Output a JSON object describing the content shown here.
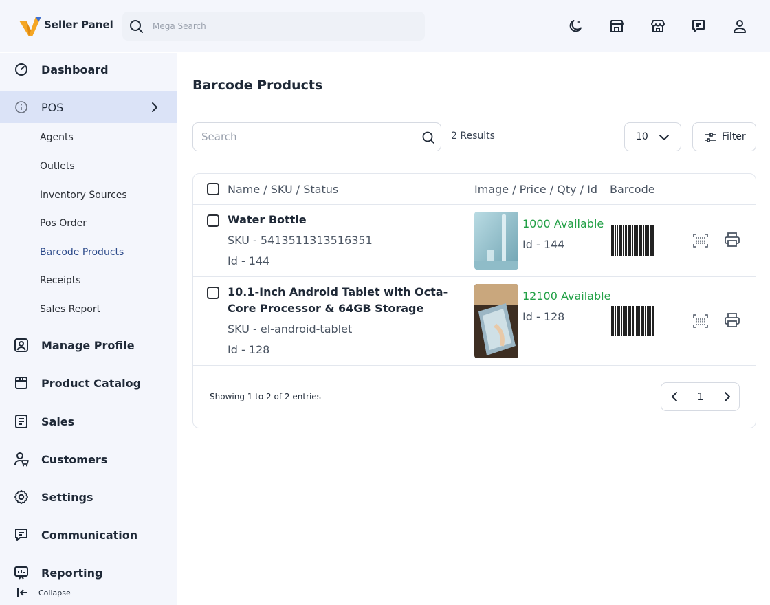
{
  "header": {
    "brand": "Seller Panel",
    "search_placeholder": "Mega Search",
    "icons": [
      "moon-icon",
      "store-icon",
      "shop-icon",
      "message-icon",
      "user-icon"
    ]
  },
  "sidebar": {
    "items": [
      {
        "label": "Dashboard",
        "icon": "dashboard-icon"
      },
      {
        "label": "POS",
        "icon": "info-icon"
      },
      {
        "label": "Manage Profile",
        "icon": "profile-icon"
      },
      {
        "label": "Product Catalog",
        "icon": "catalog-icon"
      },
      {
        "label": "Sales",
        "icon": "sales-icon"
      },
      {
        "label": "Customers",
        "icon": "customers-icon"
      },
      {
        "label": "Settings",
        "icon": "gear-icon"
      },
      {
        "label": "Communication",
        "icon": "message-icon"
      },
      {
        "label": "Reporting",
        "icon": "report-icon"
      }
    ],
    "pos_submenu": [
      "Agents",
      "Outlets",
      "Inventory Sources",
      "Pos Order",
      "Barcode Products",
      "Receipts",
      "Sales Report"
    ],
    "collapse_label": "Collapse"
  },
  "main": {
    "title": "Barcode Products",
    "search_placeholder": "Search",
    "results": "2 Results",
    "page_size": "10",
    "filter_label": "Filter",
    "table": {
      "headers": [
        "Name / SKU / Status",
        "Image / Price / Qty / Id",
        "Barcode"
      ],
      "rows": [
        {
          "name": "Water Bottle",
          "sku": "SKU - 5413511313516351",
          "id_text": "Id - 144",
          "available": "1000 Available",
          "qty_id": "Id - 144"
        },
        {
          "name": "10.1-Inch Android Tablet with Octa-Core Processor & 64GB Storage",
          "sku": "SKU - el-android-tablet",
          "id_text": "Id - 128",
          "available": "12100 Available",
          "qty_id": "Id - 128"
        }
      ]
    },
    "showing": "Showing 1 to 2 of 2 entries",
    "current_page": "1"
  },
  "colors": {
    "accent": "#2c4a8a",
    "available": "#22a046",
    "active_bg": "#dbe3f7",
    "logo_orange": "#f5a623"
  }
}
